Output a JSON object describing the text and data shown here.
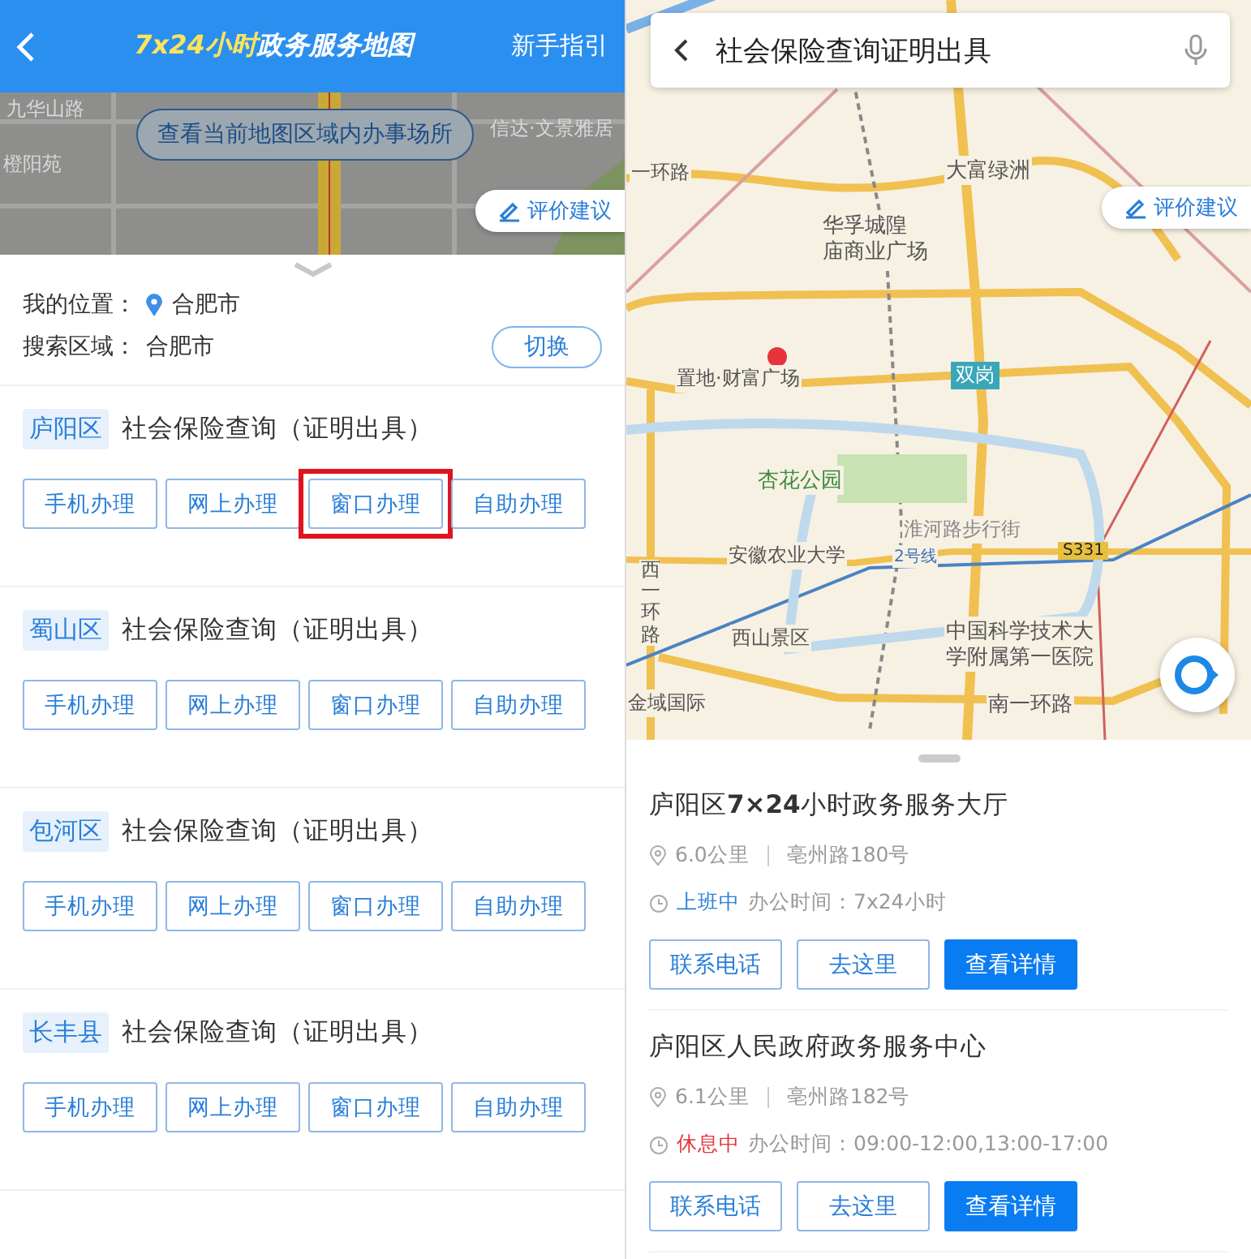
{
  "left": {
    "header": {
      "title_parts": [
        {
          "text": "7x24小时",
          "kind": "accent"
        },
        {
          "text": "政务服务地图",
          "kind": "plain"
        }
      ],
      "guide": "新手指引"
    },
    "map": {
      "labels": [
        "九华山路",
        "信达·文景雅居",
        "橙阳苑"
      ],
      "area_button": "查看当前地图区域内办事场所",
      "feedback": "评价建议"
    },
    "location": {
      "my_label": "我的位置：",
      "my_value": "合肥市",
      "area_label": "搜索区域：",
      "area_value": "合肥市",
      "switch": "切换"
    },
    "services": [
      {
        "district": "庐阳区",
        "title": "社会保险查询（证明出具）",
        "actions": [
          {
            "label": "手机办理",
            "highlighted": false
          },
          {
            "label": "网上办理",
            "highlighted": false
          },
          {
            "label": "窗口办理",
            "highlighted": true
          },
          {
            "label": "自助办理",
            "highlighted": false
          }
        ]
      },
      {
        "district": "蜀山区",
        "title": "社会保险查询（证明出具）",
        "actions": [
          {
            "label": "手机办理",
            "highlighted": false
          },
          {
            "label": "网上办理",
            "highlighted": false
          },
          {
            "label": "窗口办理",
            "highlighted": false
          },
          {
            "label": "自助办理",
            "highlighted": false
          }
        ]
      },
      {
        "district": "包河区",
        "title": "社会保险查询（证明出具）",
        "actions": [
          {
            "label": "手机办理",
            "highlighted": false
          },
          {
            "label": "网上办理",
            "highlighted": false
          },
          {
            "label": "窗口办理",
            "highlighted": false
          },
          {
            "label": "自助办理",
            "highlighted": false
          }
        ]
      },
      {
        "district": "长丰县",
        "title": "社会保险查询（证明出具）",
        "actions": [
          {
            "label": "手机办理",
            "highlighted": false
          },
          {
            "label": "网上办理",
            "highlighted": false
          },
          {
            "label": "窗口办理",
            "highlighted": false
          },
          {
            "label": "自助办理",
            "highlighted": false
          }
        ]
      }
    ]
  },
  "right": {
    "search": {
      "value": "社会保险查询证明出具"
    },
    "map": {
      "feedback": "评价建议",
      "labels": [
        "一环路",
        "大富绿洲",
        "华孚城隍",
        "庙商业广场",
        "置地·财富广场",
        "双岗",
        "杏花公园",
        "淮河路步行街",
        "安徽农业大学",
        "2号线",
        "S331",
        "西一环路",
        "西山景区",
        "中国科学技术大",
        "学附属第一医院",
        "金域国际",
        "南一环路"
      ]
    },
    "results": [
      {
        "name": "庐阳区**7×24**小时政务服务大厅",
        "distance": "6.0公里",
        "address": "亳州路180号",
        "status": "上班中",
        "open": true,
        "hours": "办公时间：7x24小时",
        "buttons": [
          {
            "label": "联系电话",
            "kind": "outline"
          },
          {
            "label": "去这里",
            "kind": "outline"
          },
          {
            "label": "查看详情",
            "kind": "primary"
          }
        ]
      },
      {
        "name": "庐阳区人民政府政务服务中心",
        "distance": "6.1公里",
        "address": "亳州路182号",
        "status": "休息中",
        "open": false,
        "hours": "办公时间：09:00-12:00,13:00-17:00",
        "buttons": [
          {
            "label": "联系电话",
            "kind": "outline"
          },
          {
            "label": "去这里",
            "kind": "outline"
          },
          {
            "label": "查看详情",
            "kind": "primary"
          }
        ]
      }
    ]
  }
}
